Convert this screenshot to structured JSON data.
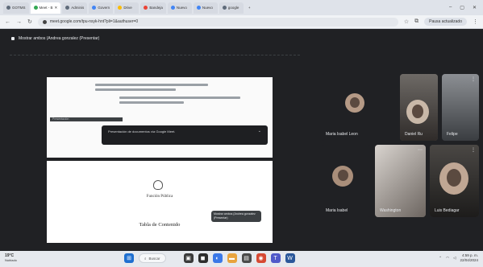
{
  "browser": {
    "tabs": [
      {
        "label": "GOTMS",
        "active": false
      },
      {
        "label": "Meet - B",
        "active": true
      },
      {
        "label": "Adminis",
        "active": false
      },
      {
        "label": "Govern",
        "active": false
      },
      {
        "label": "Drive",
        "active": false
      },
      {
        "label": "Bandeja",
        "active": false
      },
      {
        "label": "Nuevo",
        "active": false
      },
      {
        "label": "Nuevo",
        "active": false
      },
      {
        "label": "google",
        "active": false
      }
    ],
    "url": "meet.google.com/tpu-nsyk-hnt?pli=1&authuser=0",
    "profile_label": "Pausa actualizado"
  },
  "meet": {
    "presenting_banner": "Mostrar ambos (Andrea gonzalez (Presentar)",
    "shared_doc": {
      "strip_label": "Presentación",
      "toast_text": "Presentación de documentos vía Google Meet.",
      "org_name": "Función Pública",
      "title": "Tabla de Contenido",
      "footer_label": "Documento"
    },
    "tooltip_text": "Mostrar ambos (Andrea gonzalez (Presentar)",
    "participants": [
      {
        "name": "Maria Isabel Leon"
      },
      {
        "name": "Daniel Ru"
      },
      {
        "name": "Felipe"
      },
      {
        "name": "Maria Isabel"
      },
      {
        "name": "Washington"
      },
      {
        "name": "Luis Bediagar"
      }
    ],
    "meeting_code": "tpu-nsyk-hnt"
  },
  "taskbar": {
    "weather_temp": "19°C",
    "weather_desc": "Nublado",
    "search_placeholder": "Buscar",
    "time": "4:59 p. m.",
    "date": "22/04/2024"
  },
  "colors": {
    "meet_bg": "#202124",
    "tile_bg": "#3c4043",
    "end_call": "#ea4335",
    "chrome_bg": "#dfe3ea"
  }
}
